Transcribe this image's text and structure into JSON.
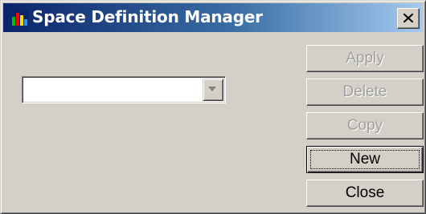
{
  "window": {
    "title": "Space Definition Manager",
    "close_glyph": "✕"
  },
  "combo": {
    "value": "",
    "arrow_icon": "chevron-down-icon"
  },
  "buttons": {
    "apply": "Apply",
    "delete": "Delete",
    "copy": "Copy",
    "new": "New",
    "close": "Close"
  },
  "states": {
    "apply_enabled": false,
    "delete_enabled": false,
    "copy_enabled": false,
    "new_enabled": true,
    "close_enabled": true
  },
  "colors": {
    "titlebar_start": "#0a246a",
    "titlebar_end": "#a6caf0",
    "face": "#d4d0c8"
  }
}
